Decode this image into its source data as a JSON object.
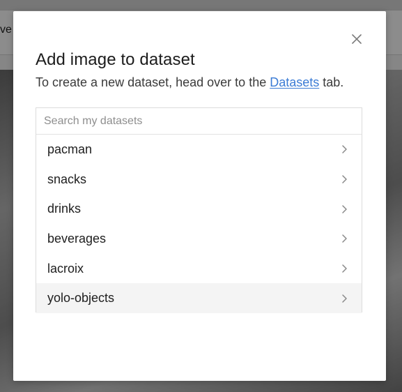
{
  "background": {
    "toolbar_text": "ve"
  },
  "modal": {
    "title": "Add image to dataset",
    "subtitle_prefix": "To create a new dataset, head over to the ",
    "subtitle_link": "Datasets",
    "subtitle_suffix": " tab.",
    "search_placeholder": "Search my datasets",
    "search_value": "",
    "datasets": [
      {
        "name": "pacman"
      },
      {
        "name": "snacks"
      },
      {
        "name": "drinks"
      },
      {
        "name": "beverages"
      },
      {
        "name": "lacroix"
      },
      {
        "name": "yolo-objects"
      }
    ],
    "highlighted_index": 5,
    "icons": {
      "close": "close-icon",
      "row_chevron": "chevron-right-icon"
    },
    "colors": {
      "link": "#3a7bd5",
      "row_highlight": "#f4f4f4"
    }
  }
}
